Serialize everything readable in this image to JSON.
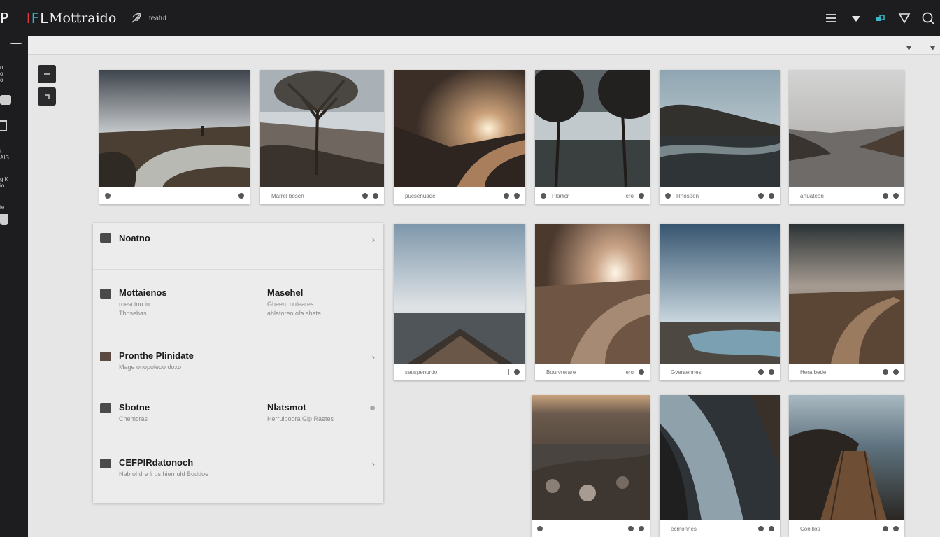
{
  "header": {
    "logo": {
      "p": "P",
      "i": "I",
      "f": "F",
      "l": "L"
    },
    "title": "Mottraido",
    "nav_label": "teatut",
    "icons": [
      "menu-icon",
      "heart-icon",
      "layers-icon",
      "filter-icon",
      "search-icon"
    ]
  },
  "sidebar": {
    "items": [
      "o\no\no",
      "",
      "",
      "t\nAIS",
      "g K\nio",
      "ie",
      ""
    ]
  },
  "gallery": {
    "row1": [
      {
        "caption": ""
      },
      {
        "caption": "Marrel bosen"
      },
      {
        "caption": "pucsenuade"
      },
      {
        "caption": "Plarlicr",
        "extra": "ero"
      },
      {
        "caption": "Rnosoen"
      },
      {
        "caption": "artuateon"
      }
    ],
    "row2": [
      {
        "caption": "seuspenurdo"
      },
      {
        "caption": "Bourvrerare",
        "extra": "ero"
      },
      {
        "caption": "Gveraennes"
      },
      {
        "caption": "Hera bede"
      }
    ],
    "row3": [
      {
        "caption": ""
      },
      {
        "caption": "ecmonnes"
      },
      {
        "caption": "Conillos"
      }
    ]
  },
  "panel": {
    "rows": [
      {
        "title": "Noatno",
        "sub": "",
        "rtitle": "",
        "rsub": ""
      },
      {
        "title": "Mottaienos",
        "sub": "roesctou in\nThpsebas",
        "rtitle": "Masehel",
        "rsub": "Gheen, ouleares\nahlatoreo ofa shate"
      },
      {
        "title": "Pronthe Plinidate",
        "sub": "Mage onopoleoo doxo",
        "rtitle": "",
        "rsub": ""
      },
      {
        "title": "Sbotne",
        "sub": "Chemcras",
        "rtitle": "Nlatsmot",
        "rsub": "Herrulpoora Gip Raetes"
      },
      {
        "title": "CEFPIRdatonoch",
        "sub": "Nab ol dre li ps hiernuld Boddoe",
        "rtitle": "",
        "rsub": ""
      }
    ]
  },
  "colors": {
    "topbar": "#1d1d20",
    "main": "#e6e6e6",
    "logo_red": "#e23b3b",
    "logo_cyan": "#37b8c9"
  }
}
